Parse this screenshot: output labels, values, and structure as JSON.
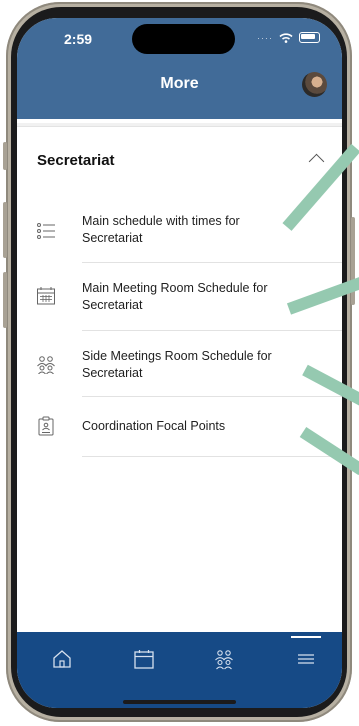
{
  "status_bar": {
    "time": "2:59"
  },
  "header": {
    "title": "More"
  },
  "section": {
    "title": "Secretariat",
    "items": [
      {
        "label": "Main schedule with times for Secretariat",
        "icon": "list-icon"
      },
      {
        "label": "Main  Meeting Room Schedule for Secretariat",
        "icon": "calendar-grid-icon"
      },
      {
        "label": "Side Meetings Room Schedule for Secretariat",
        "icon": "people-group-icon"
      },
      {
        "label": "Coordination Focal Points",
        "icon": "clipboard-person-icon"
      }
    ]
  },
  "tab_bar": {
    "tabs": [
      {
        "icon": "home-icon"
      },
      {
        "icon": "calendar-icon"
      },
      {
        "icon": "people-icon"
      },
      {
        "icon": "menu-icon",
        "active": true
      }
    ]
  },
  "colors": {
    "header": "#416b98",
    "tab_bar": "#164a86",
    "annotation_arrow": "#95c9b0"
  }
}
